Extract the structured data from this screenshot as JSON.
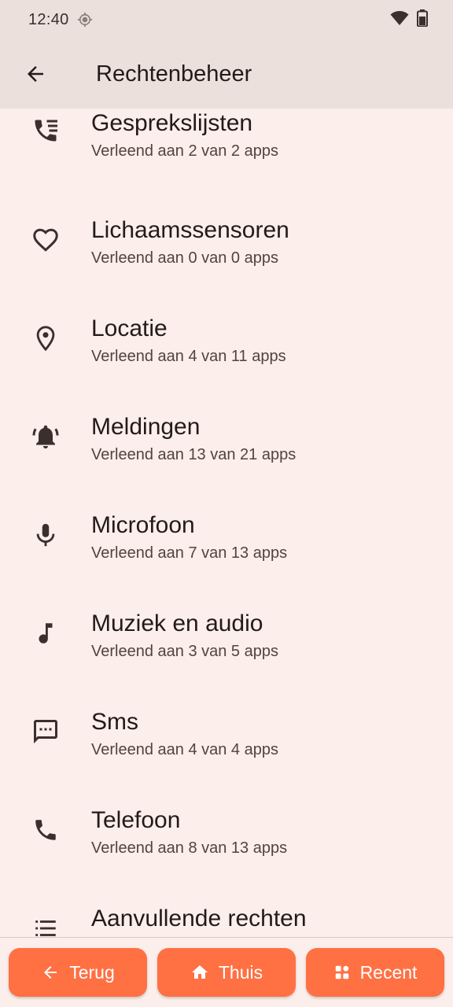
{
  "status_bar": {
    "time": "12:40"
  },
  "app_bar": {
    "title": "Rechtenbeheer"
  },
  "permissions": [
    {
      "title": "Gesprekslijsten",
      "subtitle": "Verleend aan 2 van 2 apps",
      "icon": "call-log-icon"
    },
    {
      "title": "Lichaamssensoren",
      "subtitle": "Verleend aan 0 van 0 apps",
      "icon": "heart-icon"
    },
    {
      "title": "Locatie",
      "subtitle": "Verleend aan 4 van 11 apps",
      "icon": "location-pin-icon"
    },
    {
      "title": "Meldingen",
      "subtitle": "Verleend aan 13 van 21 apps",
      "icon": "bell-icon"
    },
    {
      "title": "Microfoon",
      "subtitle": "Verleend aan 7 van 13 apps",
      "icon": "microphone-icon"
    },
    {
      "title": "Muziek en audio",
      "subtitle": "Verleend aan 3 van 5 apps",
      "icon": "music-note-icon"
    },
    {
      "title": "Sms",
      "subtitle": "Verleend aan 4 van 4 apps",
      "icon": "sms-icon"
    },
    {
      "title": "Telefoon",
      "subtitle": "Verleend aan 8 van 13 apps",
      "icon": "phone-icon"
    },
    {
      "title": "Aanvullende rechten",
      "subtitle": "",
      "icon": "list-icon"
    }
  ],
  "bottom_nav": {
    "back_label": "Terug",
    "home_label": "Thuis",
    "recent_label": "Recent"
  },
  "colors": {
    "background": "#fbeeeb",
    "app_bar": "#ece0dd",
    "accent": "#ff7043"
  }
}
